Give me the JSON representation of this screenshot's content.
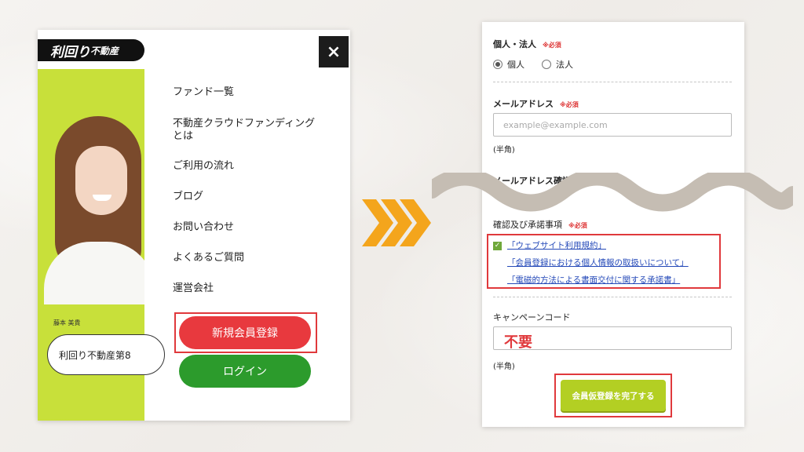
{
  "left_panel": {
    "logo_main": "利回り",
    "logo_sub": "不動産",
    "close_icon": "×",
    "person_name": "藤本 美貴",
    "person_pill": "利回り不動産第8",
    "menu": [
      "ファンド一覧",
      "不動産クラウドファンディング",
      "とは",
      "ご利用の流れ",
      "ブログ",
      "お問い合わせ",
      "よくあるご質問",
      "運営会社"
    ],
    "register_button": "新規会員登録",
    "login_button": "ログイン"
  },
  "right_panel": {
    "individual_label": "個人・法人",
    "required": "※必須",
    "radio_individual": "個人",
    "radio_corporate": "法人",
    "email_label": "メールアドレス",
    "email_placeholder": "example@example.com",
    "halfwidth": "(半角)",
    "email_confirm_label": "メールアドレス確認",
    "terms_label": "確認及び承諾事項",
    "terms_links": [
      "「ウェブサイト利用規約」",
      "「会員登録における個人情報の取扱いについて」",
      "「電磁的方法による書面交付に関する承諾書」"
    ],
    "campaign_label": "キャンペーンコード",
    "campaign_annotation": "不要",
    "submit_button": "会員仮登録を完了する"
  },
  "colors": {
    "accent_red": "#e0393c",
    "lime": "#c8e03a",
    "login_green": "#2c9b2c",
    "submit_lime": "#b3cf23",
    "arrow_orange": "#f4a51c",
    "wave": "#c5bdb3"
  },
  "icons": {
    "close": "close-icon",
    "arrows": "triple-chevron-right-icon",
    "checkbox": "checkbox-checked-icon"
  }
}
